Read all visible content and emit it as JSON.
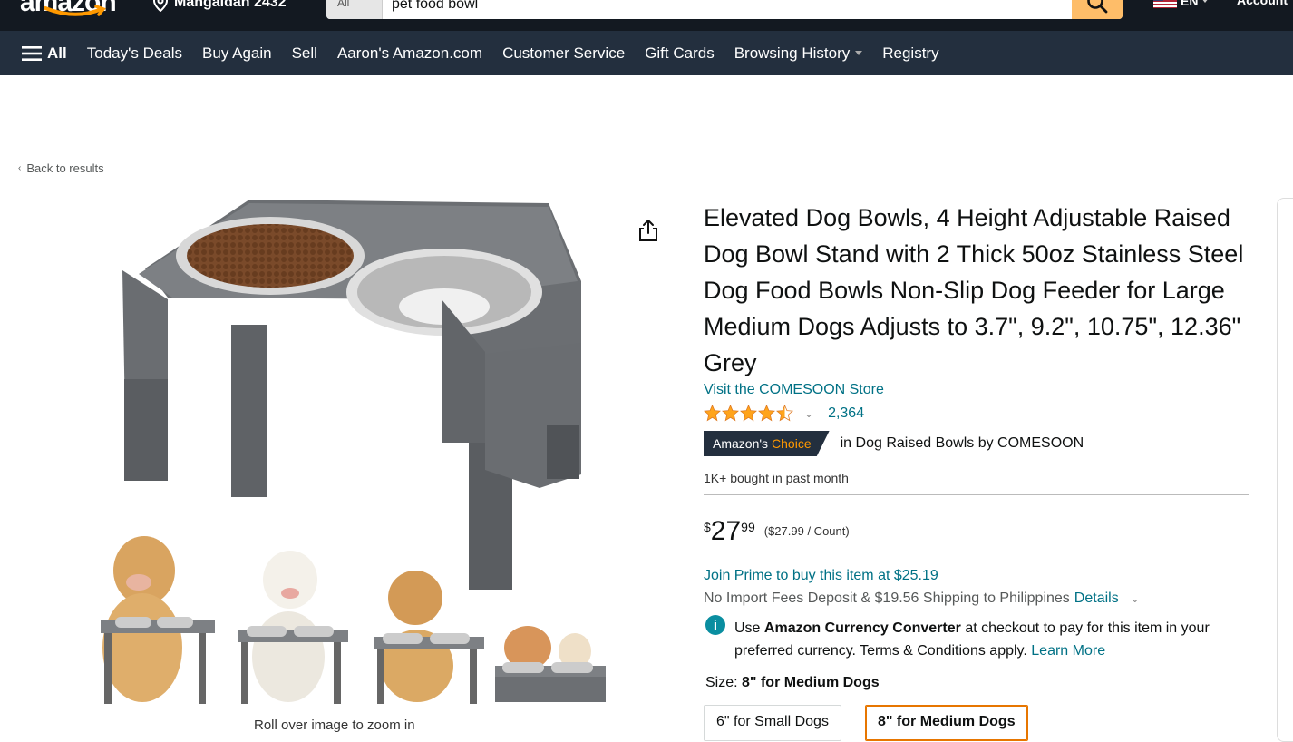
{
  "header": {
    "logo_text": "amazon",
    "location": "Mangaldan 2432",
    "search_category": "All",
    "search_value": "pet food bowl",
    "language": "EN",
    "account": "Account"
  },
  "nav": {
    "all_label": "All",
    "items": [
      "Today's Deals",
      "Buy Again",
      "Sell",
      "Aaron's Amazon.com",
      "Customer Service",
      "Gift Cards",
      "Browsing History",
      "Registry"
    ]
  },
  "breadcrumb": {
    "back": "Back to results"
  },
  "gallery": {
    "zoom_hint": "Roll over image to zoom in"
  },
  "product": {
    "title": "Elevated Dog Bowls, 4 Height Adjustable Raised Dog Bowl Stand with 2 Thick 50oz Stainless Steel Dog Food Bowls Non-Slip Dog Feeder for Large Medium Dogs Adjusts to 3.7\", 9.2\", 10.75\", 12.36\" Grey",
    "store_link": "Visit the COMESOON Store",
    "rating": 4.5,
    "rating_count": "2,364",
    "badge_prefix": "Amazon's",
    "badge_choice": "Choice",
    "badge_category": "in Dog Raised Bowls by COMESOON",
    "bought": "1K+ bought in past month",
    "price_symbol": "$",
    "price_whole": "27",
    "price_fraction": "99",
    "price_per": "($27.99 / Count)",
    "prime_offer": "Join Prime to buy this item at $25.19",
    "shipping_text": "No Import Fees Deposit & $19.56 Shipping to Philippines",
    "shipping_link": "Details",
    "converter_prefix": "Use",
    "converter_bold": "Amazon Currency Converter",
    "converter_text": "at checkout to pay for this item in your preferred currency. Terms & Conditions apply.",
    "converter_link": "Learn More",
    "size_label": "Size:",
    "size_selected": "8\" for Medium Dogs",
    "size_options": [
      "6\" for Small Dogs",
      "8\" for Medium Dogs"
    ]
  },
  "colors": {
    "header_bg": "#131921",
    "nav_bg": "#232f3e",
    "link": "#007185",
    "star": "#ffa41c",
    "accent": "#febd69"
  }
}
